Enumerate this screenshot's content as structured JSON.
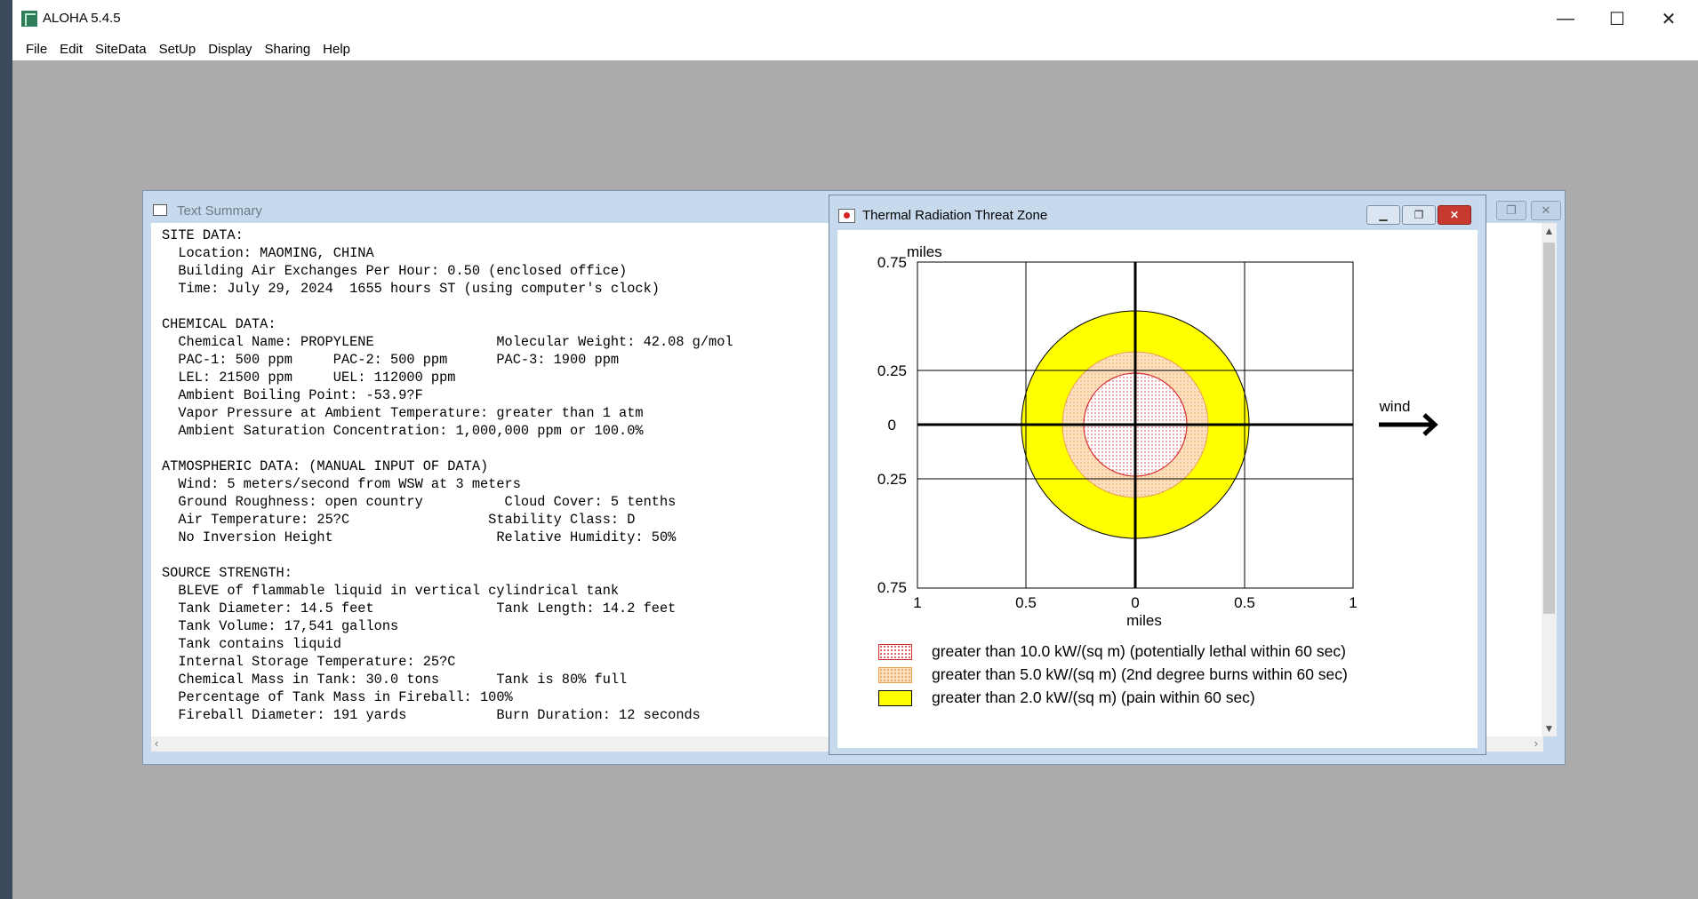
{
  "app": {
    "title": "ALOHA 5.4.5",
    "window_controls": {
      "minimize": "—",
      "maximize": "☐",
      "close": "✕"
    },
    "menu": [
      "File",
      "Edit",
      "SiteData",
      "SetUp",
      "Display",
      "Sharing",
      "Help"
    ]
  },
  "text_summary": {
    "title": "Text Summary",
    "lines": [
      "SITE DATA:",
      "  Location: MAOMING, CHINA",
      "  Building Air Exchanges Per Hour: 0.50 (enclosed office)",
      "  Time: July 29, 2024  1655 hours ST (using computer's clock)",
      "",
      "CHEMICAL DATA:",
      "  Chemical Name: PROPYLENE               Molecular Weight: 42.08 g/mol",
      "  PAC-1: 500 ppm     PAC-2: 500 ppm      PAC-3: 1900 ppm",
      "  LEL: 21500 ppm     UEL: 112000 ppm",
      "  Ambient Boiling Point: -53.9?F",
      "  Vapor Pressure at Ambient Temperature: greater than 1 atm",
      "  Ambient Saturation Concentration: 1,000,000 ppm or 100.0%",
      "",
      "ATMOSPHERIC DATA: (MANUAL INPUT OF DATA)",
      "  Wind: 5 meters/second from WSW at 3 meters",
      "  Ground Roughness: open country          Cloud Cover: 5 tenths",
      "  Air Temperature: 25?C                 Stability Class: D",
      "  No Inversion Height                    Relative Humidity: 50%",
      "",
      "SOURCE STRENGTH:",
      "  BLEVE of flammable liquid in vertical cylindrical tank",
      "  Tank Diameter: 14.5 feet               Tank Length: 14.2 feet",
      "  Tank Volume: 17,541 gallons",
      "  Tank contains liquid",
      "  Internal Storage Temperature: 25?C",
      "  Chemical Mass in Tank: 30.0 tons       Tank is 80% full",
      "  Percentage of Tank Mass in Fireball: 100%",
      "  Fireball Diameter: 191 yards           Burn Duration: 12 seconds"
    ]
  },
  "threat_zone": {
    "title": "Thermal Radiation Threat Zone",
    "y_unit": "miles",
    "x_unit": "miles",
    "y_ticks": [
      "0.75",
      "0.25",
      "0",
      "0.25",
      "0.75"
    ],
    "x_ticks": [
      "1",
      "0.5",
      "0",
      "0.5",
      "1"
    ],
    "wind_label": "wind",
    "legend": [
      "greater than 10.0 kW/(sq m) (potentially lethal within 60 sec)",
      "greater than 5.0 kW/(sq m) (2nd degree burns within 60 sec)",
      "greater than 2.0 kW/(sq m) (pain within 60 sec)"
    ],
    "zone_radii_miles": [
      0.24,
      0.34,
      0.53
    ],
    "colors": {
      "red_zone": "#d63030",
      "orange_zone": "#fde0c0",
      "yellow_zone": "#ffff00"
    }
  }
}
